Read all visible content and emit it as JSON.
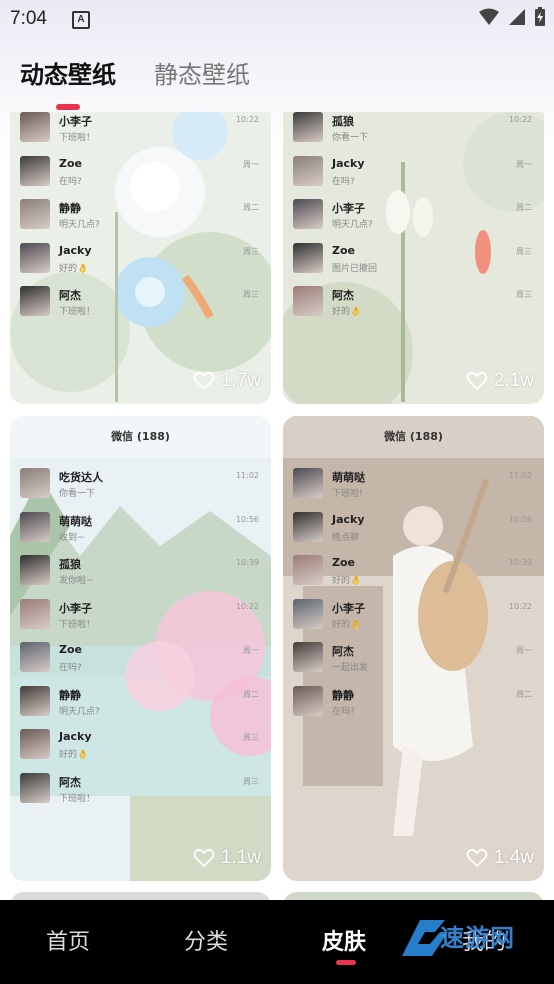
{
  "status": {
    "time": "7:04",
    "notif": "A"
  },
  "tabs": {
    "active": "动态壁纸",
    "inactive": "静态壁纸"
  },
  "cards": [
    {
      "likes": "1.7w",
      "chats": [
        {
          "name": "小李子",
          "msg": "下班啦！",
          "time": "10:22"
        },
        {
          "name": "Zoe",
          "msg": "在吗?",
          "time": "周一"
        },
        {
          "name": "静静",
          "msg": "明天几点?",
          "time": "周二"
        },
        {
          "name": "Jacky",
          "msg": "好的👌",
          "time": "周三"
        },
        {
          "name": "阿杰",
          "msg": "下班啦！",
          "time": "周三"
        }
      ]
    },
    {
      "likes": "2.1w",
      "chats": [
        {
          "name": "孤狼",
          "msg": "你看一下",
          "time": "10:22"
        },
        {
          "name": "Jacky",
          "msg": "在吗?",
          "time": "周一"
        },
        {
          "name": "小李子",
          "msg": "明天几点?",
          "time": "周二"
        },
        {
          "name": "Zoe",
          "msg": "图片已撤回",
          "time": "周三"
        },
        {
          "name": "阿杰",
          "msg": "好的👌",
          "time": "周三"
        }
      ]
    },
    {
      "header": "微信 (188)",
      "likes": "1.1w",
      "chats": [
        {
          "name": "吃货达人",
          "msg": "你看一下",
          "time": "11:02"
        },
        {
          "name": "萌萌哒",
          "msg": "收到~",
          "time": "10:56"
        },
        {
          "name": "孤狼",
          "msg": "发你啦~",
          "time": "10:39"
        },
        {
          "name": "小李子",
          "msg": "下班啦！",
          "time": "10:22"
        },
        {
          "name": "Zoe",
          "msg": "在吗?",
          "time": "周一"
        },
        {
          "name": "静静",
          "msg": "明天几点?",
          "time": "周二"
        },
        {
          "name": "Jacky",
          "msg": "好的👌",
          "time": "周三"
        },
        {
          "name": "阿杰",
          "msg": "下班啦！",
          "time": "周三"
        }
      ]
    },
    {
      "header": "微信 (188)",
      "likes": "1.4w",
      "chats": [
        {
          "name": "萌萌哒",
          "msg": "下班啦!",
          "time": "11:02"
        },
        {
          "name": "Jacky",
          "msg": "晚点聊",
          "time": "10:56"
        },
        {
          "name": "Zoe",
          "msg": "好的👌",
          "time": "10:39"
        },
        {
          "name": "小李子",
          "msg": "好的👌",
          "time": "10:22"
        },
        {
          "name": "阿杰",
          "msg": "一起出发",
          "time": "周一"
        },
        {
          "name": "静静",
          "msg": "在吗?",
          "time": "周二"
        }
      ]
    }
  ],
  "nav": {
    "home": "首页",
    "category": "分类",
    "skin": "皮肤",
    "mine": "我的"
  },
  "watermark": {
    "text": "速游网"
  }
}
